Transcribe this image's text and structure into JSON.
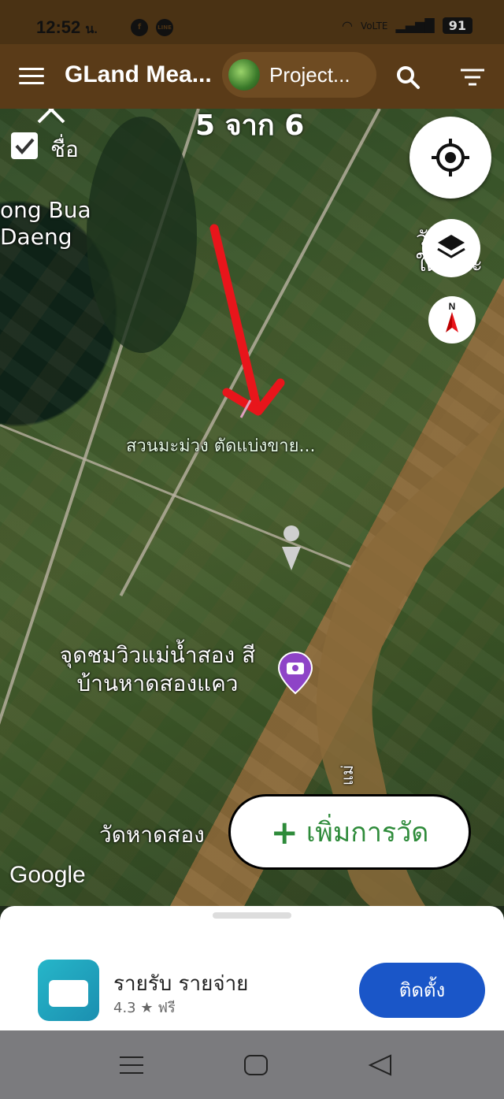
{
  "status_bar": {
    "time": "12:52",
    "time_suffix": "น.",
    "net_label": "VoLTE",
    "battery": "91"
  },
  "app_bar": {
    "title": "GLand Mea...",
    "project_label": "Project...",
    "icons": [
      "menu-icon",
      "search-icon",
      "filter-icon"
    ]
  },
  "map": {
    "counter": "5 จาก 6",
    "name_toggle_label": "ชื่อ",
    "name_toggle_checked": true,
    "labels": {
      "lake": "ong Bua Daeng",
      "temple_right": "วัด ใต้(พระ",
      "plot": "สวนมะม่วง ตัดแบ่งขาย...",
      "viewpoint": "จุดชมวิวแม่น้ำสอง สี บ้านหาดสองแคว",
      "temple_bottom": "วัดหาดสอง",
      "river": "แม่",
      "google": "Google"
    },
    "compass_letter": "N",
    "add_measure_label": "เพิ่มการวัด",
    "colors": {
      "arrow": "#e8151b",
      "accent_green": "#2e8b3a",
      "pin": "#8e44c7"
    }
  },
  "ad": {
    "title": "รายรับ รายจ่าย",
    "rating": "4.3",
    "price": "ฟรี",
    "install_label": "ติดตั้ง",
    "install_color": "#1a56c8"
  },
  "nav_bar": {
    "icons": [
      "recents-icon",
      "home-icon",
      "back-icon"
    ]
  }
}
